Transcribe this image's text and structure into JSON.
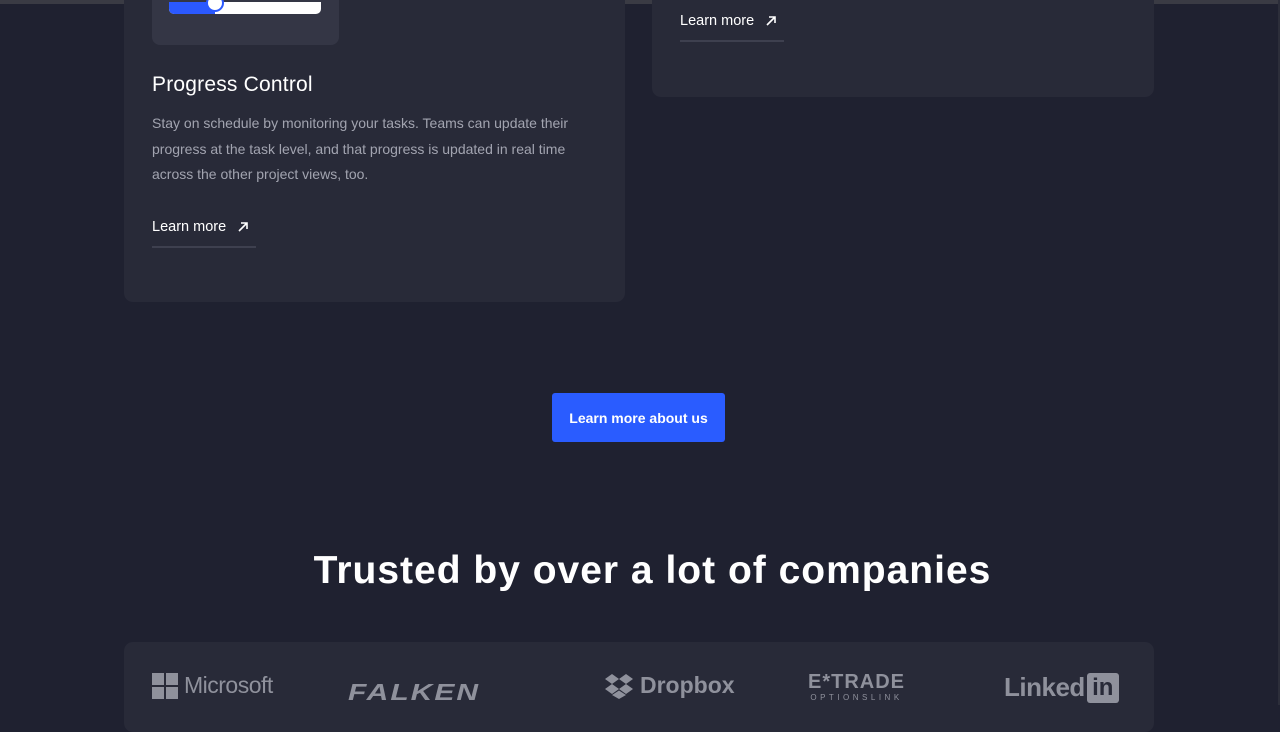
{
  "features": {
    "progress": {
      "title": "Progress Control",
      "description": "Stay on schedule by monitoring your tasks. Teams can update their progress at the task level, and that progress is updated in real time across the other project views, too.",
      "link_label": "Learn more",
      "slider_value": 0.3
    },
    "right_card": {
      "link_label": "Learn more"
    }
  },
  "cta": {
    "label": "Learn more about us"
  },
  "trusted": {
    "heading": "Trusted by over a lot of companies",
    "logos": {
      "microsoft": "Microsoft",
      "falken": "FALKEN",
      "dropbox": "Dropbox",
      "etrade": "E*TRADE",
      "etrade_sub": "OPTIONSLINK",
      "linkedin": "Linked",
      "linkedin_box": "in"
    }
  },
  "colors": {
    "background": "#1f2130",
    "card": "#282a38",
    "accent": "#2a5cff",
    "muted_text": "#a2a4b0",
    "logo": "#8f919c"
  }
}
